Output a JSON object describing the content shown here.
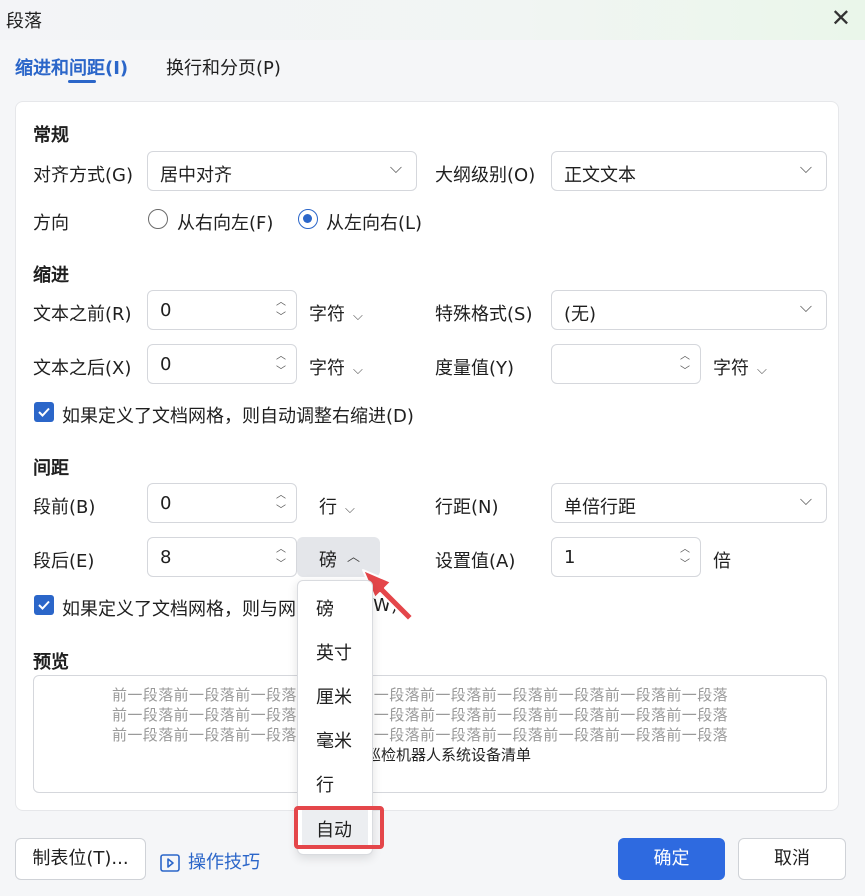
{
  "window": {
    "title": "段落"
  },
  "tabs": [
    {
      "label": "缩进和间距(I)",
      "active": true
    },
    {
      "label": "换行和分页(P)",
      "active": false
    }
  ],
  "general": {
    "heading": "常规",
    "align_label": "对齐方式(G)",
    "align_value": "居中对齐",
    "outline_label": "大纲级别(O)",
    "outline_value": "正文文本",
    "direction_label": "方向",
    "rtl_label": "从右向左(F)",
    "ltr_label": "从左向右(L)",
    "direction_selected": "ltr"
  },
  "indent": {
    "heading": "缩进",
    "before_label": "文本之前(R)",
    "before_value": "0",
    "before_unit": "字符",
    "after_label": "文本之后(X)",
    "after_value": "0",
    "after_unit": "字符",
    "special_label": "特殊格式(S)",
    "special_value": "(无)",
    "measure_label": "度量值(Y)",
    "measure_value": "",
    "measure_unit": "字符",
    "grid_checkbox": "如果定义了文档网格，则自动调整右缩进(D)"
  },
  "spacing": {
    "heading": "间距",
    "before_label": "段前(B)",
    "before_value": "0",
    "before_unit": "行",
    "after_label": "段后(E)",
    "after_value": "8",
    "after_unit": "磅",
    "line_label": "行距(N)",
    "line_value": "单倍行距",
    "setting_label": "设置值(A)",
    "setting_value": "1",
    "setting_unit": "倍",
    "grid_checkbox_prefix": "如果定义了文档网格，则与网",
    "grid_checkbox_suffix": "(W)"
  },
  "unit_menu": {
    "items": [
      "磅",
      "英寸",
      "厘米",
      "毫米",
      "行",
      "自动"
    ],
    "highlighted": "自动"
  },
  "preview": {
    "heading": "预览",
    "prev_line": "前一段落前一段落前一段落前一段落前一段落前一段落前一段落前一段落前一段落前一段落",
    "current_text": "巡检机器人系统设备清单"
  },
  "footer": {
    "tabs_button": "制表位(T)...",
    "tips_link": "操作技巧",
    "ok_button": "确定",
    "cancel_button": "取消"
  },
  "colors": {
    "accent": "#2e6ae0",
    "highlight_red": "#e4464a"
  }
}
